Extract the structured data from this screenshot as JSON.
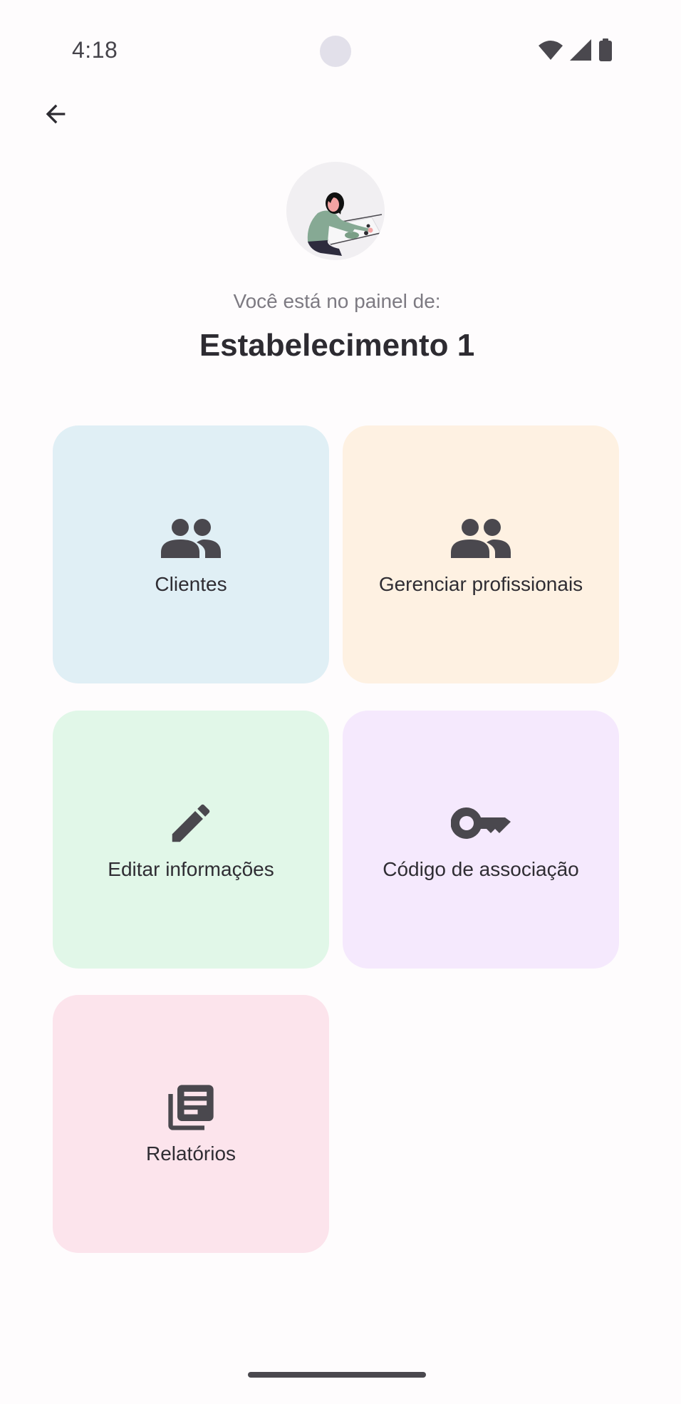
{
  "status_bar": {
    "time": "4:18",
    "icons": [
      "wifi-icon",
      "cellular-signal-icon",
      "battery-icon"
    ]
  },
  "header": {
    "back_icon": "arrow-left-icon",
    "avatar_icon": "person-at-desk-illustration",
    "subtitle": "Você está no painel de:",
    "title": "Estabelecimento 1"
  },
  "cards": [
    {
      "label": "Clientes",
      "icon": "people-icon",
      "color": "#e0eff5"
    },
    {
      "label": "Gerenciar profissionais",
      "icon": "people-icon",
      "color": "#fef1e2"
    },
    {
      "label": "Editar informações",
      "icon": "pencil-icon",
      "color": "#e1f7e8"
    },
    {
      "label": "Código de associação",
      "icon": "key-icon",
      "color": "#f5e9fd"
    },
    {
      "label": "Relatórios",
      "icon": "library-books-icon",
      "color": "#fce4ec"
    }
  ],
  "colors": {
    "icon": "#4a484e",
    "text": "#2f2d33",
    "subtitle": "#7d7a82",
    "background": "#fefcfd"
  }
}
